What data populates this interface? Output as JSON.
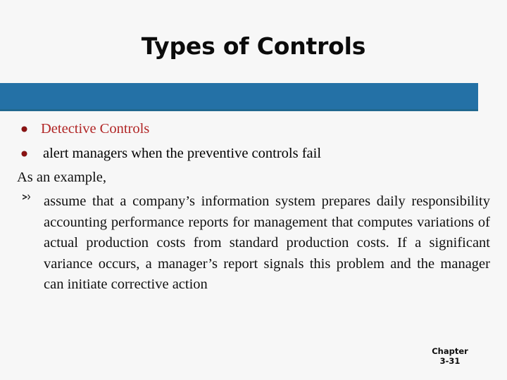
{
  "slide": {
    "title": "Types of Controls",
    "accent_color": "#2471a6",
    "highlight_text_color": "#b12626",
    "bullets": [
      {
        "marker": "round-dot",
        "text": "Detective Controls",
        "color": "#b12626"
      },
      {
        "marker": "round-dot",
        "text": "alert managers when the preventive controls fail",
        "color": "#101010"
      }
    ],
    "lead_in": "As an example,",
    "example": {
      "marker": "arrow-bullet",
      "text": "assume that a company’s information system prepares daily responsibility accounting performance reports for management that computes variations of actual production costs from standard production costs. If a significant variance occurs, a manager’s report signals this problem and the manager can initiate corrective action"
    },
    "footer": {
      "label": "Chapter",
      "number": "3-31"
    }
  }
}
